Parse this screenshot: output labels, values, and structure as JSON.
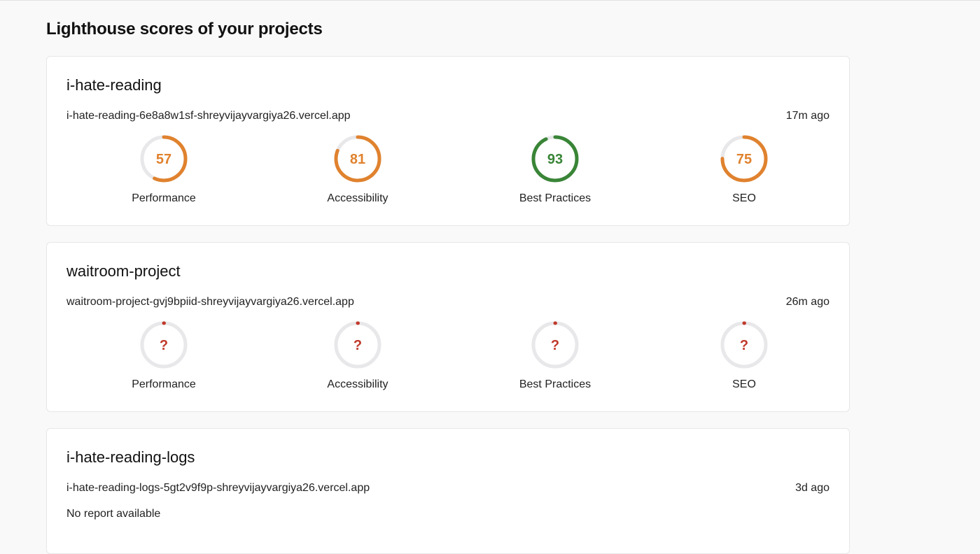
{
  "page": {
    "title": "Lighthouse scores of your projects"
  },
  "colors": {
    "orange": "#e0822e",
    "green": "#398537",
    "red": "#c0392b"
  },
  "projects": [
    {
      "name": "i-hate-reading",
      "url": "i-hate-reading-6e8a8w1sf-shreyvijayvargiya26.vercel.app",
      "time": "17m ago",
      "scores": [
        {
          "label": "Performance",
          "value": "57",
          "fraction": 0.57,
          "status": "orange"
        },
        {
          "label": "Accessibility",
          "value": "81",
          "fraction": 0.81,
          "status": "orange"
        },
        {
          "label": "Best Practices",
          "value": "93",
          "fraction": 0.93,
          "status": "green"
        },
        {
          "label": "SEO",
          "value": "75",
          "fraction": 0.75,
          "status": "orange"
        }
      ]
    },
    {
      "name": "waitroom-project",
      "url": "waitroom-project-gvj9bpiid-shreyvijayvargiya26.vercel.app",
      "time": "26m ago",
      "scores": [
        {
          "label": "Performance",
          "value": "?",
          "fraction": 0,
          "status": "red"
        },
        {
          "label": "Accessibility",
          "value": "?",
          "fraction": 0,
          "status": "red"
        },
        {
          "label": "Best Practices",
          "value": "?",
          "fraction": 0,
          "status": "red"
        },
        {
          "label": "SEO",
          "value": "?",
          "fraction": 0,
          "status": "red"
        }
      ]
    },
    {
      "name": "i-hate-reading-logs",
      "url": "i-hate-reading-logs-5gt2v9f9p-shreyvijayvargiya26.vercel.app",
      "time": "3d ago",
      "message": "No report available"
    }
  ]
}
